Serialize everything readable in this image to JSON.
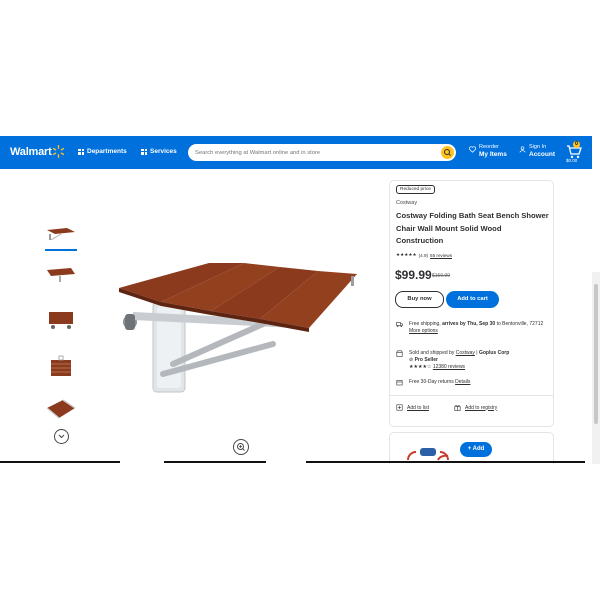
{
  "header": {
    "logo": "Walmart",
    "departments": "Departments",
    "services": "Services",
    "search_placeholder": "Search everything at Walmart online and in store",
    "reorder_top": "Reorder",
    "reorder_bottom": "My Items",
    "signin_top": "Sign In",
    "signin_bottom": "Account",
    "cart_count": "0",
    "cart_total": "$0.00"
  },
  "product": {
    "badge": "Reduced price",
    "brand": "Costway",
    "title": "Costway Folding Bath Seat Bench Shower Chair Wall Mount Solid Wood Construction",
    "rating_stars": "★★★★★",
    "rating_value": "(4.9)",
    "rating_link": "55 reviews",
    "price": "$99.99",
    "was_price": "$159.99",
    "buy_now": "Buy now",
    "add_to_cart": "Add to cart"
  },
  "fulfillment": {
    "shipping_pre": "Free shipping,",
    "shipping_bold": "arrives by Thu, Sep 30",
    "shipping_post": "to Bentonville, 72712",
    "more_options": "More options",
    "sold_pre": "Sold and shipped by",
    "seller": "Costway",
    "seller_alt": "Goplus Corp",
    "pro_seller": "Pro Seller",
    "seller_stars": "★★★★☆",
    "seller_reviews": "12380 reviews",
    "returns": "Free 30-Day returns",
    "returns_link": "Details"
  },
  "actions": {
    "add_to_list": "Add to list",
    "add_to_registry": "Add to registry"
  },
  "related": {
    "add_label": "+ Add"
  },
  "colors": {
    "brand_blue": "#0071dc",
    "spark_yellow": "#ffc220",
    "wood": "#8b3a1e"
  }
}
